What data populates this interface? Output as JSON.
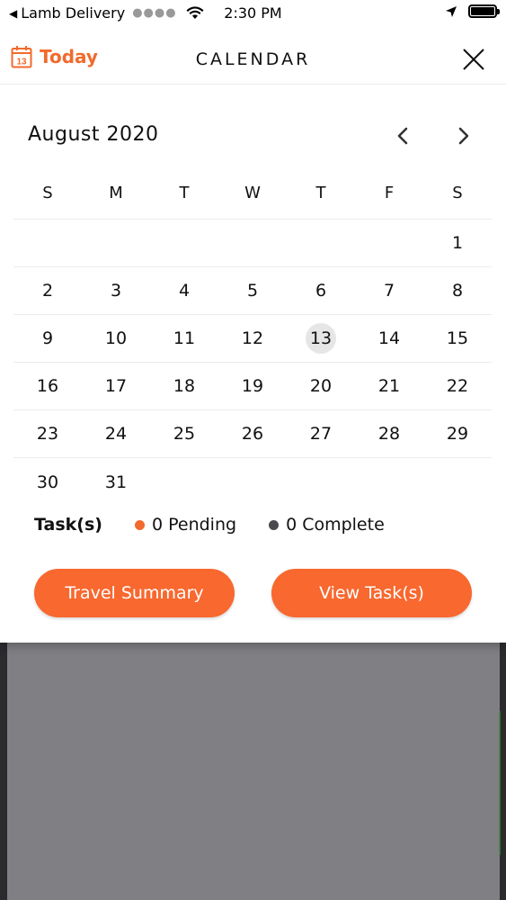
{
  "status_bar": {
    "back_app": "Lamb Delivery",
    "time": "2:30 PM"
  },
  "header": {
    "today_label": "Today",
    "today_icon_day": "13",
    "title": "CALENDAR"
  },
  "calendar": {
    "month_label": "August 2020",
    "weekdays": [
      "S",
      "M",
      "T",
      "W",
      "T",
      "F",
      "S"
    ],
    "weeks": [
      [
        "",
        "",
        "",
        "",
        "",
        "",
        "1"
      ],
      [
        "2",
        "3",
        "4",
        "5",
        "6",
        "7",
        "8"
      ],
      [
        "9",
        "10",
        "11",
        "12",
        "13",
        "14",
        "15"
      ],
      [
        "16",
        "17",
        "18",
        "19",
        "20",
        "21",
        "22"
      ],
      [
        "23",
        "24",
        "25",
        "26",
        "27",
        "28",
        "29"
      ],
      [
        "30",
        "31",
        "",
        "",
        "",
        "",
        ""
      ]
    ],
    "selected_day": "13"
  },
  "tasks": {
    "label": "Task(s)",
    "pending": "0 Pending",
    "complete": "0 Complete"
  },
  "buttons": {
    "travel_summary": "Travel Summary",
    "view_tasks": "View Task(s)"
  },
  "colors": {
    "accent": "#f8682f",
    "pending_dot": "#f26a2c",
    "complete_dot": "#4a4a4f",
    "selected_bg": "#e6e6e6"
  },
  "icons": {
    "today": "calendar-icon",
    "close": "close-icon",
    "prev": "chevron-left-icon",
    "next": "chevron-right-icon"
  }
}
